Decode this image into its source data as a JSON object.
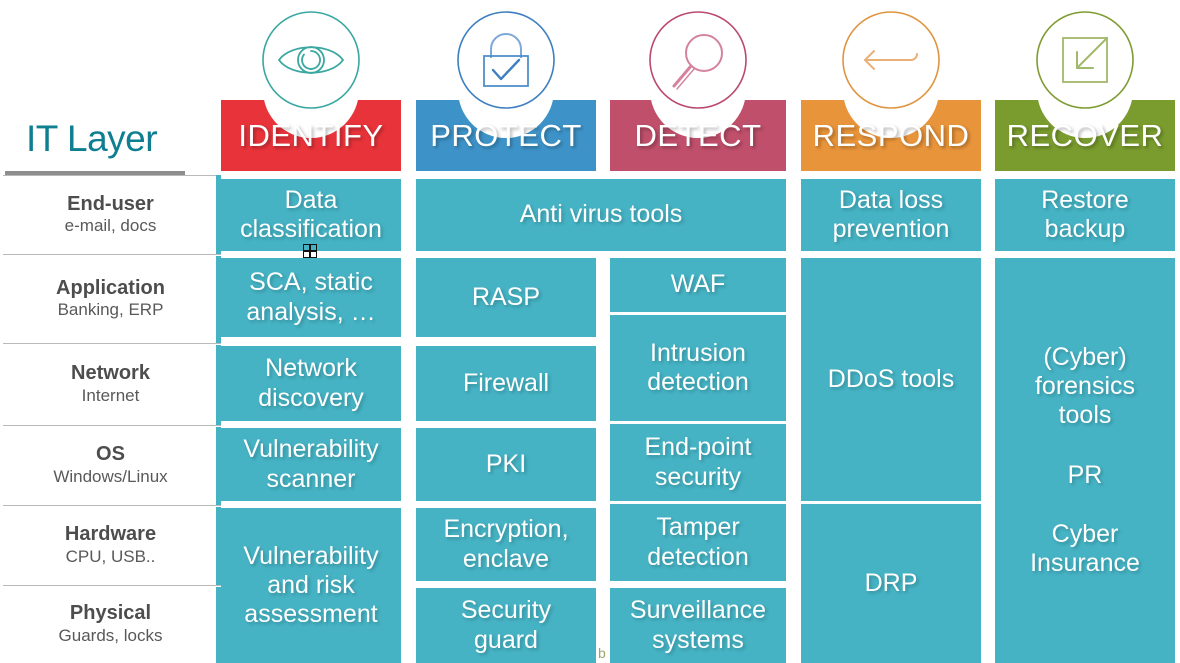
{
  "title": "IT Layer",
  "colors": {
    "cell_teal": "#45b3c4",
    "title_teal": "#0e7e91",
    "identify": "#e8333a",
    "protect": "#3d93c8",
    "detect": "#bf4f6b",
    "respond": "#e8943a",
    "recover": "#7a9c2e"
  },
  "functions": [
    {
      "id": "identify",
      "label": "IDENTIFY",
      "color": "#e8333a",
      "icon": "eye-icon",
      "icon_color": "#3aa8a0"
    },
    {
      "id": "protect",
      "label": "PROTECT",
      "color": "#3d93c8",
      "icon": "lock-check-icon",
      "icon_color": "#3d7fc0"
    },
    {
      "id": "detect",
      "label": "DETECT",
      "color": "#bf4f6b",
      "icon": "magnifier-icon",
      "icon_color": "#c05878"
    },
    {
      "id": "respond",
      "label": "RESPOND",
      "color": "#e8943a",
      "icon": "left-arrow-icon",
      "icon_color": "#e09440"
    },
    {
      "id": "recover",
      "label": "RECOVER",
      "color": "#7a9c2e",
      "icon": "restore-square-icon",
      "icon_color": "#7f9c33"
    }
  ],
  "layers": [
    {
      "name": "End-user",
      "sub": "e-mail, docs"
    },
    {
      "name": "Application",
      "sub": "Banking, ERP"
    },
    {
      "name": "Network",
      "sub": "Internet"
    },
    {
      "name": "OS",
      "sub": "Windows/Linux"
    },
    {
      "name": "Hardware",
      "sub": "CPU, USB.."
    },
    {
      "name": "Physical",
      "sub": "Guards, locks"
    }
  ],
  "cells": [
    {
      "id": "c1",
      "lines": [
        "Data",
        "classification"
      ]
    },
    {
      "id": "c2",
      "lines": [
        "SCA, static",
        "analysis, …"
      ]
    },
    {
      "id": "c3",
      "lines": [
        "Network",
        "discovery"
      ]
    },
    {
      "id": "c4",
      "lines": [
        "Vulnerability",
        "scanner"
      ]
    },
    {
      "id": "c5",
      "lines": [
        "Vulnerability",
        "and risk",
        "assessment"
      ]
    },
    {
      "id": "c6",
      "lines": [
        "Anti virus tools"
      ]
    },
    {
      "id": "c7",
      "lines": [
        "RASP"
      ]
    },
    {
      "id": "c8",
      "lines": [
        "Firewall"
      ]
    },
    {
      "id": "c9",
      "lines": [
        "PKI"
      ]
    },
    {
      "id": "c10",
      "lines": [
        "Encryption,",
        "enclave"
      ]
    },
    {
      "id": "c11",
      "lines": [
        "Security",
        "guard"
      ]
    },
    {
      "id": "c12",
      "lines": [
        "WAF"
      ]
    },
    {
      "id": "c13",
      "lines": [
        "Intrusion",
        "detection"
      ]
    },
    {
      "id": "c14",
      "lines": [
        "End-point",
        "security"
      ]
    },
    {
      "id": "c15",
      "lines": [
        "Tamper",
        "detection"
      ]
    },
    {
      "id": "c16",
      "lines": [
        "Surveillance",
        "systems"
      ]
    },
    {
      "id": "c17",
      "lines": [
        "Data loss",
        "prevention"
      ]
    },
    {
      "id": "c18",
      "lines": [
        "DDoS tools"
      ]
    },
    {
      "id": "c19",
      "lines": [
        "DRP"
      ]
    },
    {
      "id": "c20",
      "lines": [
        "Restore",
        "backup"
      ]
    },
    {
      "id": "c21a",
      "lines": [
        "(Cyber)",
        "forensics",
        "tools"
      ]
    },
    {
      "id": "c21b",
      "lines": [
        "PR"
      ]
    },
    {
      "id": "c21c",
      "lines": [
        "Cyber",
        "Insurance"
      ]
    }
  ],
  "watermark": "b"
}
